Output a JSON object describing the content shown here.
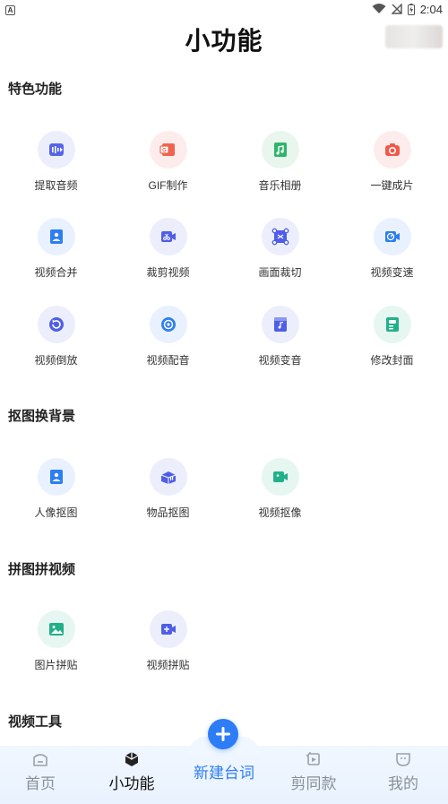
{
  "status_bar": {
    "left_badge": "A",
    "time": "2:04"
  },
  "header": {
    "title": "小功能"
  },
  "sections": [
    {
      "title": "特色功能",
      "items": [
        {
          "label": "提取音频",
          "icon": "audio-extract-icon",
          "bg": "#eceefc",
          "fg": "#5664e8"
        },
        {
          "label": "GIF制作",
          "icon": "gif-icon",
          "bg": "#fdecec",
          "fg": "#f0644f"
        },
        {
          "label": "音乐相册",
          "icon": "music-album-icon",
          "bg": "#e8f6ee",
          "fg": "#2fb56a"
        },
        {
          "label": "一键成片",
          "icon": "camera-icon",
          "bg": "#fdecec",
          "fg": "#f05a4a"
        },
        {
          "label": "视频合并",
          "icon": "video-merge-icon",
          "bg": "#e8f1fd",
          "fg": "#2c7ef2"
        },
        {
          "label": "裁剪视频",
          "icon": "video-cut-icon",
          "bg": "#eceefc",
          "fg": "#4f5ee8"
        },
        {
          "label": "画面裁切",
          "icon": "crop-icon",
          "bg": "#eceefc",
          "fg": "#4f5ee8"
        },
        {
          "label": "视频变速",
          "icon": "speed-icon",
          "bg": "#e8f1fd",
          "fg": "#2c7ef2"
        },
        {
          "label": "视频倒放",
          "icon": "reverse-icon",
          "bg": "#eceefc",
          "fg": "#4f5ee8"
        },
        {
          "label": "视频配音",
          "icon": "dubbing-icon",
          "bg": "#e8f1fd",
          "fg": "#2c7ef2"
        },
        {
          "label": "视频变音",
          "icon": "voice-change-icon",
          "bg": "#eceefc",
          "fg": "#4f5ee8"
        },
        {
          "label": "修改封面",
          "icon": "cover-icon",
          "bg": "#e6f6f1",
          "fg": "#22b08a"
        }
      ]
    },
    {
      "title": "抠图换背景",
      "items": [
        {
          "label": "人像抠图",
          "icon": "portrait-cutout-icon",
          "bg": "#e8f1fd",
          "fg": "#2c7ef2"
        },
        {
          "label": "物品抠图",
          "icon": "object-cutout-icon",
          "bg": "#eceefc",
          "fg": "#4f5ee8"
        },
        {
          "label": "视频抠像",
          "icon": "video-cutout-icon",
          "bg": "#e6f6f1",
          "fg": "#22b08a"
        }
      ]
    },
    {
      "title": "拼图拼视频",
      "items": [
        {
          "label": "图片拼贴",
          "icon": "image-collage-icon",
          "bg": "#e6f6f1",
          "fg": "#22b08a"
        },
        {
          "label": "视频拼贴",
          "icon": "video-collage-icon",
          "bg": "#eceefc",
          "fg": "#4f5ee8"
        }
      ]
    },
    {
      "title": "视频工具",
      "items": []
    }
  ],
  "bottom_nav": {
    "items": [
      {
        "label": "首页",
        "icon": "home-icon",
        "active": false
      },
      {
        "label": "小功能",
        "icon": "cube-icon",
        "active": true
      },
      {
        "label": "新建台词",
        "icon": "plus-icon",
        "active": false
      },
      {
        "label": "剪同款",
        "icon": "template-icon",
        "active": false
      },
      {
        "label": "我的",
        "icon": "profile-icon",
        "active": false
      }
    ]
  }
}
